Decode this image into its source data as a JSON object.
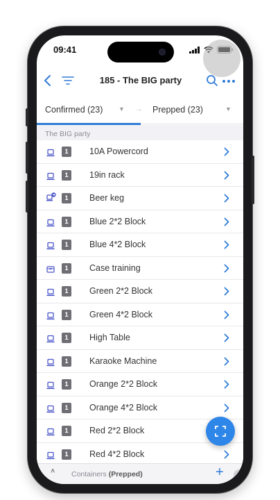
{
  "status_bar": {
    "time": "09:41"
  },
  "nav": {
    "title": "185 - The BIG party"
  },
  "tabs": {
    "from": {
      "label": "Confirmed (23)"
    },
    "to": {
      "label": "Prepped (23)"
    }
  },
  "section": {
    "title": "The BIG party"
  },
  "items": [
    {
      "label": "10A Powercord",
      "qty": "1",
      "icon": "item-icon"
    },
    {
      "label": "19in rack",
      "qty": "1",
      "icon": "item-icon"
    },
    {
      "label": "Beer keg",
      "qty": "1",
      "icon": "item-forward-icon"
    },
    {
      "label": "Blue 2*2 Block",
      "qty": "1",
      "icon": "item-icon"
    },
    {
      "label": "Blue 4*2 Block",
      "qty": "1",
      "icon": "item-icon"
    },
    {
      "label": "Case training",
      "qty": "1",
      "icon": "case-icon"
    },
    {
      "label": "Green 2*2 Block",
      "qty": "1",
      "icon": "item-icon"
    },
    {
      "label": "Green 4*2 Block",
      "qty": "1",
      "icon": "item-icon"
    },
    {
      "label": "High Table",
      "qty": "1",
      "icon": "item-icon"
    },
    {
      "label": "Karaoke Machine",
      "qty": "1",
      "icon": "item-icon"
    },
    {
      "label": "Orange 2*2 Block",
      "qty": "1",
      "icon": "item-icon"
    },
    {
      "label": "Orange 4*2 Block",
      "qty": "1",
      "icon": "item-icon"
    },
    {
      "label": "Red 2*2 Block",
      "qty": "1",
      "icon": "item-icon"
    },
    {
      "label": "Red 4*2 Block",
      "qty": "1",
      "icon": "item-icon"
    }
  ],
  "bottom_bar": {
    "label": "Containers",
    "status": "(Prepped)"
  },
  "colors": {
    "accent": "#2e7bd6",
    "fab": "#2e86e8",
    "badge": "#6e6e74",
    "item_icon": "#4a56c8"
  }
}
